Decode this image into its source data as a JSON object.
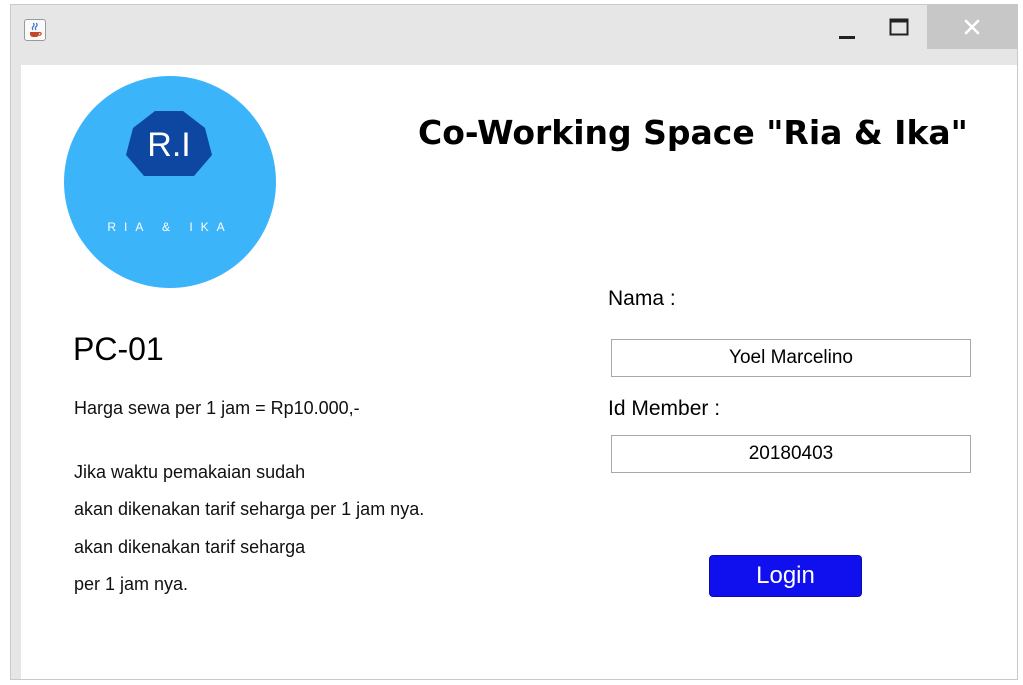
{
  "window": {
    "icon": "java-cup-icon",
    "controls": [
      "minimize-icon",
      "maximize-icon",
      "close-icon"
    ]
  },
  "logo": {
    "monogram": "R.I",
    "tagline": "RIA & IKA",
    "circle_color": "#3bb4fa",
    "heptagon_color": "#0d47a1"
  },
  "header": {
    "title": "Co-Working Space \"Ria & Ika\""
  },
  "station": {
    "id": "PC-01",
    "price": "Harga sewa per 1 jam = Rp10.000,-",
    "notice_lines": [
      "Jika waktu pemakaian sudah",
      "akan dikenakan tarif seharga per 1 jam nya.",
      "akan dikenakan tarif seharga",
      "per 1 jam nya."
    ]
  },
  "form": {
    "name_label": "Nama :",
    "name_value": "Yoel Marcelino",
    "member_label": "Id Member :",
    "member_value": "20180403",
    "login_label": "Login",
    "login_color": "#1010ee"
  }
}
